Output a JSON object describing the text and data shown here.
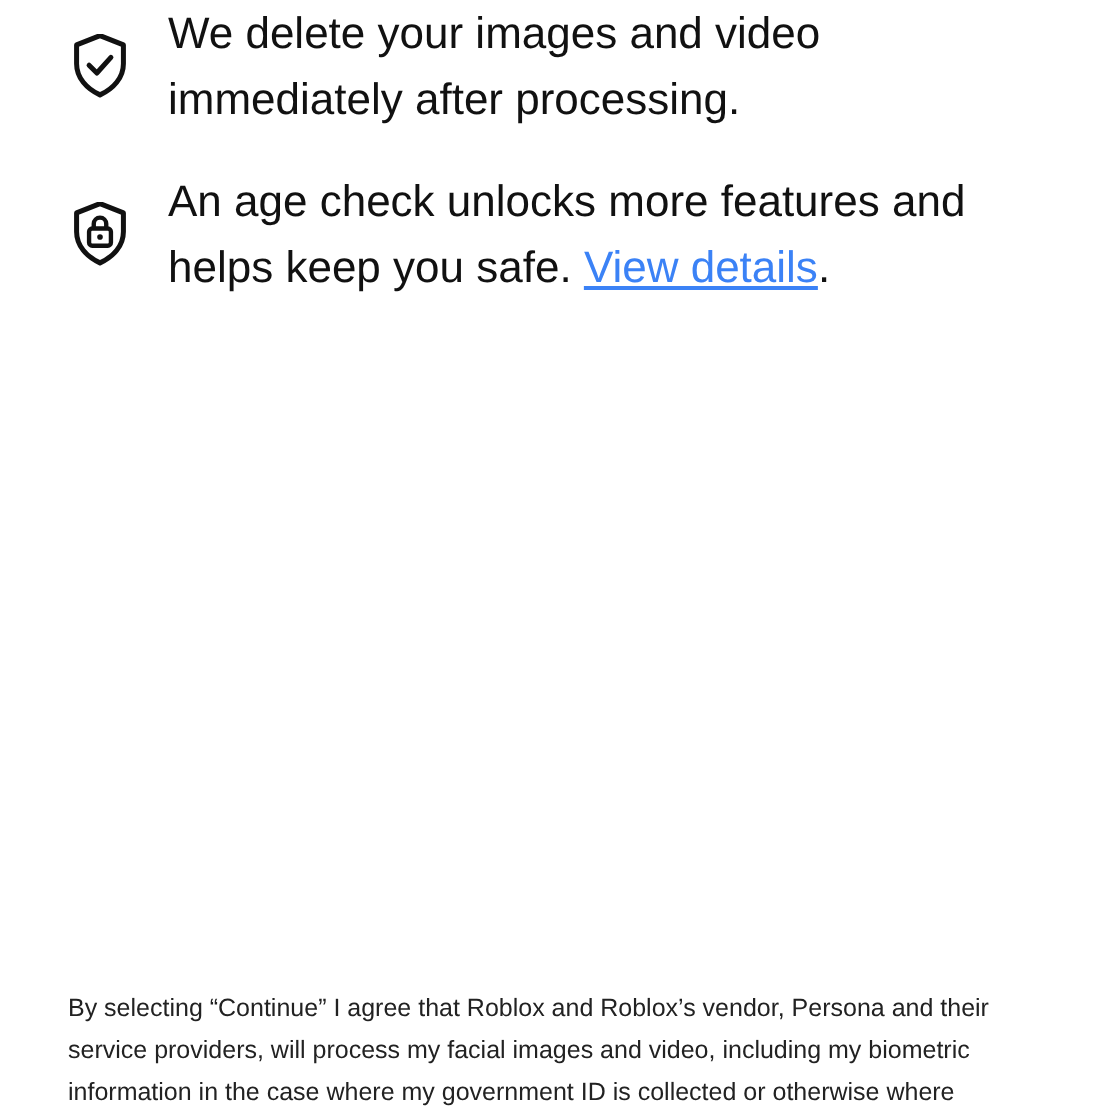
{
  "features": [
    {
      "kind": "shield-check",
      "text": "We delete your images and video immediately after processing."
    },
    {
      "kind": "shield-lock",
      "text": "An age check unlocks more features and helps keep you safe.",
      "link": "View details",
      "after_link": "."
    }
  ],
  "consent": "By selecting “Continue” I agree that Roblox and Roblox’s vendor, Persona and their service providers, will process my facial images and video, including my biometric information in the case where my government ID is collected or otherwise where"
}
